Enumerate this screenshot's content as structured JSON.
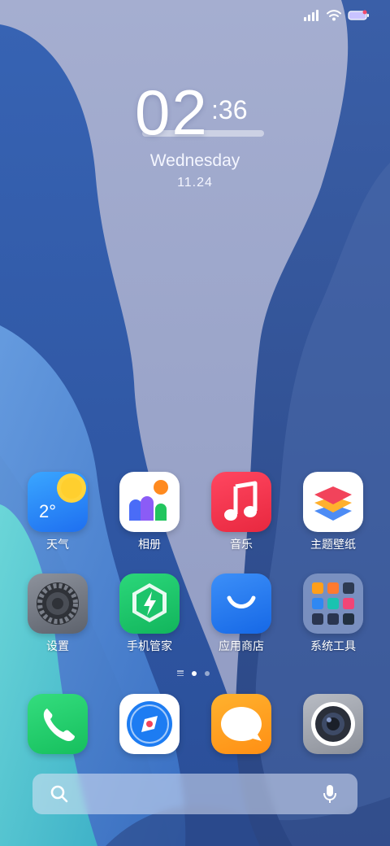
{
  "status_bar": {
    "icons": [
      "signal-icon",
      "wifi-icon",
      "battery-icon"
    ]
  },
  "clock": {
    "hours": "02",
    "minutes": ":36",
    "weekday": "Wednesday",
    "date": "11.24"
  },
  "apps": [
    {
      "label": "天气",
      "icon": "weather-icon",
      "temp": "2°"
    },
    {
      "label": "相册",
      "icon": "gallery-icon"
    },
    {
      "label": "音乐",
      "icon": "music-icon"
    },
    {
      "label": "主题壁纸",
      "icon": "themes-icon"
    },
    {
      "label": "设置",
      "icon": "settings-icon"
    },
    {
      "label": "手机管家",
      "icon": "security-icon"
    },
    {
      "label": "应用商店",
      "icon": "app-store-icon"
    },
    {
      "label": "系统工具",
      "icon": "folder-icon"
    }
  ],
  "dock": [
    {
      "icon": "phone-icon"
    },
    {
      "icon": "browser-icon"
    },
    {
      "icon": "messages-icon"
    },
    {
      "icon": "camera-icon"
    }
  ],
  "page_indicator": {
    "pages": 2,
    "active": 1
  },
  "search_bar": {
    "icons": [
      "search-icon",
      "microphone-icon"
    ]
  },
  "colors": {
    "wallpaper_sky": "#9aa4c8",
    "wallpaper_blue": "#2f5aa8",
    "wallpaper_teal": "#5ccbd4",
    "music": "#f0364d",
    "security": "#1fc46b",
    "appstore": "#1f7cf2",
    "messages": "#ffa022",
    "phone": "#22cc6a"
  }
}
